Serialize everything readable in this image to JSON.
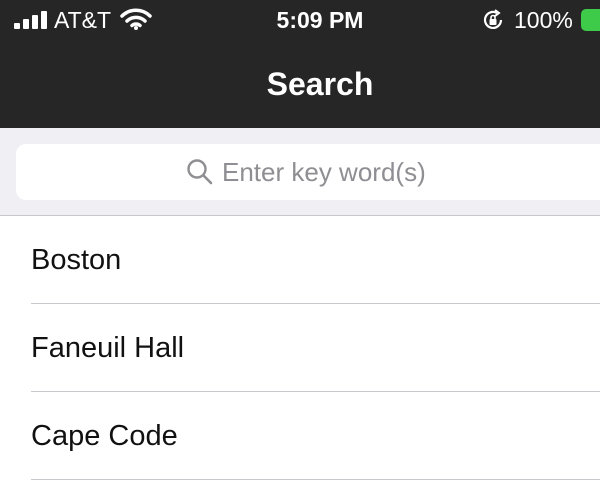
{
  "status_bar": {
    "carrier": "AT&T",
    "time": "5:09 PM",
    "battery_percent": "100%",
    "battery_color": "#3ecb4a",
    "icons": [
      "signal-icon",
      "wifi-icon",
      "rotation-lock-icon",
      "battery-icon"
    ]
  },
  "nav": {
    "title": "Search",
    "background": "#262626"
  },
  "search": {
    "placeholder": "Enter key word(s)",
    "value": "",
    "icon": "search-icon"
  },
  "results": [
    {
      "label": "Boston"
    },
    {
      "label": "Faneuil Hall"
    },
    {
      "label": "Cape Code"
    }
  ]
}
